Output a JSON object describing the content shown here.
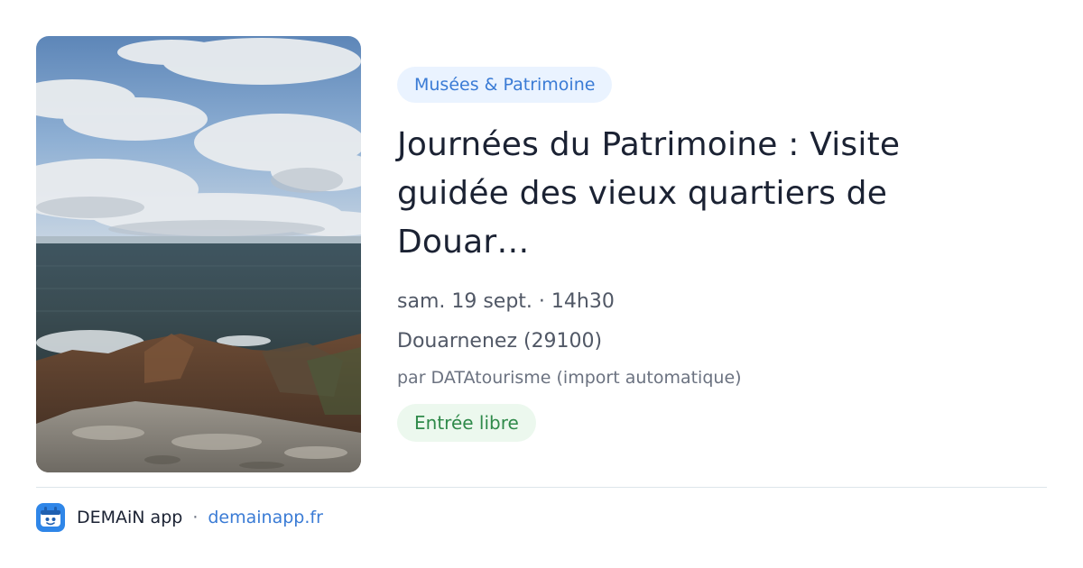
{
  "event": {
    "category": "Musées & Patrimoine",
    "title": "Journées du Patrimoine : Visite guidée des vieux quartiers de Douar…",
    "datetime": "sam. 19 sept. · 14h30",
    "location": "Douarnenez (29100)",
    "organizer": "par DATAtourisme (import automatique)",
    "price": "Entrée libre",
    "image": "coastal-seascape-photo"
  },
  "footer": {
    "app_name": "DEMAiN app",
    "separator": "·",
    "domain": "demainapp.fr",
    "logo_icon": "demain-app-logo-icon"
  },
  "colors": {
    "accent_blue": "#3a7bd5",
    "category_bg": "#eaf3ff",
    "price_text": "#2f8a4a",
    "price_bg": "#ecf8ee",
    "title_text": "#1b2233"
  }
}
